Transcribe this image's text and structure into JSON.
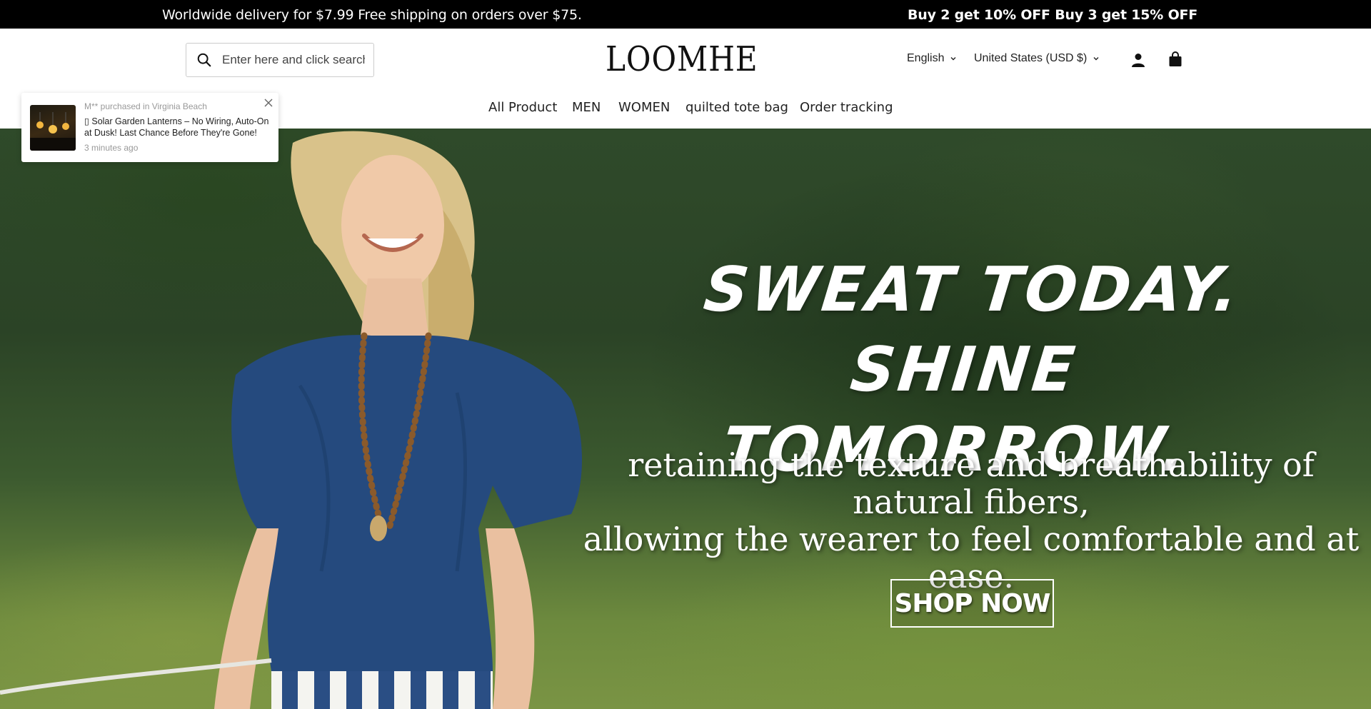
{
  "announcement": {
    "left": "Worldwide delivery for $7.99 Free shipping on orders over $75.",
    "right": "Buy 2 get 10% OFF  Buy 3 get 15% OFF"
  },
  "header": {
    "search_placeholder": "Enter here and click search",
    "logo": "LOOMHE",
    "language": "English",
    "currency": "United States (USD $)",
    "icons": [
      "search-icon",
      "user-icon",
      "shopping-bag-icon",
      "chevron-down-icon"
    ]
  },
  "nav": {
    "items": [
      {
        "label": "All Product"
      },
      {
        "label": "MEN"
      },
      {
        "label": "WOMEN"
      },
      {
        "label": "quilted tote bag"
      },
      {
        "label": "Order tracking"
      }
    ]
  },
  "popup": {
    "who": "M** purchased in Virginia Beach",
    "product": "▯ Solar Garden Lanterns – No Wiring, Auto-On at Dusk! Last Chance Before They're Gone!",
    "ago": "3 minutes ago"
  },
  "hero": {
    "headline_line1": "SWEAT TODAY.",
    "headline_line2": "SHINE TOMORROW.",
    "sub_line1": "retaining the texture and breathability of natural fibers,",
    "sub_line2": "allowing the wearer to feel comfortable and at ease.",
    "cta": "SHOP NOW"
  },
  "colors": {
    "announcement_bg": "#000000",
    "text": "#111111",
    "hero_green": "#2f4a2a"
  }
}
